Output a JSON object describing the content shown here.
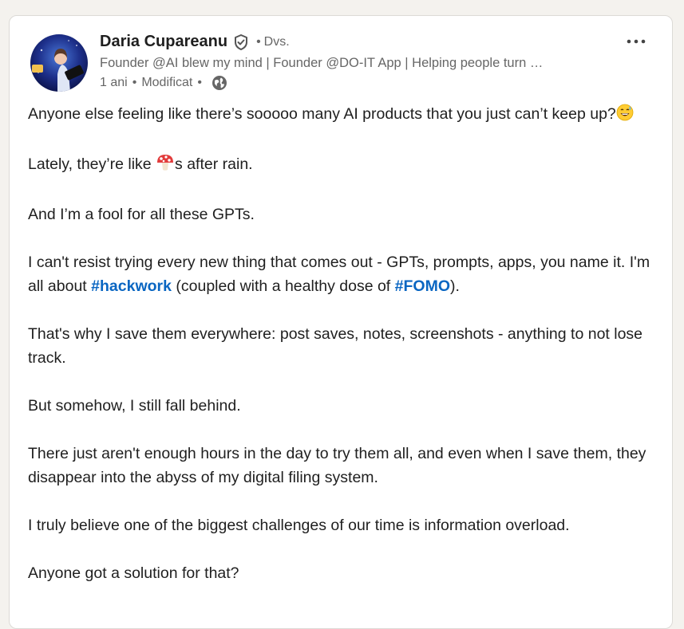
{
  "post": {
    "author": {
      "name": "Daria Cupareanu",
      "relation_sep": "•",
      "relation": "Dvs.",
      "headline": "Founder @AI blew my mind | Founder @DO-IT App | Helping people turn …"
    },
    "meta": {
      "time": "1 ani",
      "sep1": "•",
      "edited": "Modificat",
      "sep2": "•"
    },
    "body": {
      "p1": "Anyone else feeling like there’s sooooo many AI products that you just can’t keep up?",
      "p2_before": "Lately, they’re like ",
      "p2_after": "s after rain.",
      "p3": "And I’m a fool for all these GPTs.",
      "p4_before": "I can't resist trying every new thing that comes out - GPTs, prompts, apps, you name it. I'm all about ",
      "hashtag1": "#hackwork",
      "p4_middle": " (coupled with a healthy dose of ",
      "hashtag2": "#FOMO",
      "p4_after": ").",
      "p5": "That's why I save them everywhere: post saves, notes, screenshots - anything to not lose track.",
      "p6": "But somehow, I still fall behind.",
      "p7": "There just aren't enough hours in the day to try them all, and even when I save them, they disappear into the abyss of my digital filing system.",
      "p8": "I truly believe one of the biggest challenges of our time is information overload.",
      "p9": "Anyone got a solution for that?"
    }
  },
  "colors": {
    "hashtag": "#0a66c2",
    "text": "#1f1f1f",
    "muted": "#666666"
  },
  "icons": {
    "verified": "verified-shield-icon",
    "globe": "globe-icon",
    "more": "more-options-icon",
    "emoji1": "sweat-smile-emoji",
    "emoji2": "mushroom-emoji"
  }
}
